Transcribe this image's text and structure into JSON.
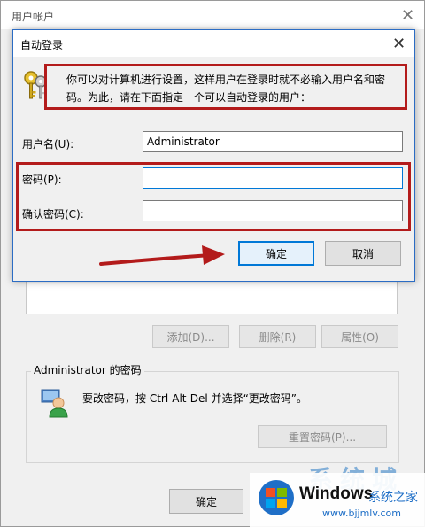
{
  "back_window": {
    "title": "用户帐户",
    "buttons": {
      "add": "添加(D)...",
      "remove": "删除(R)",
      "properties": "属性(O)"
    },
    "password_group": {
      "title": "Administrator 的密码",
      "text": "要改密码，按 Ctrl-Alt-Del 并选择“更改密码”。",
      "reset_button": "重置密码(P)..."
    },
    "ok_button": "确定"
  },
  "dialog": {
    "title": "自动登录",
    "message_line1": "你可以对计算机进行设置，这样用户在登录时就不必输入用户名和密",
    "message_line2": "码。为此，请在下面指定一个可以自动登录的用户：",
    "username_label": "用户名(U):",
    "username_value": "Administrator",
    "password_label": "密码(P):",
    "password_value": "",
    "confirm_label": "确认密码(C):",
    "confirm_value": "",
    "ok_button": "确定",
    "cancel_button": "取消"
  },
  "watermark": {
    "brand": "Windows",
    "site_name": "系统之家",
    "url": "www.bjjmlv.com",
    "partial_text": "系统城"
  },
  "colors": {
    "annotation_red": "#b31b1b",
    "focus_blue": "#0078d7",
    "dialog_border": "#2b6cc4"
  },
  "icons": {
    "dialog": "keys-icon",
    "user": "user-icon",
    "close": "close-icon",
    "arrow": "red-arrow-annotation"
  }
}
